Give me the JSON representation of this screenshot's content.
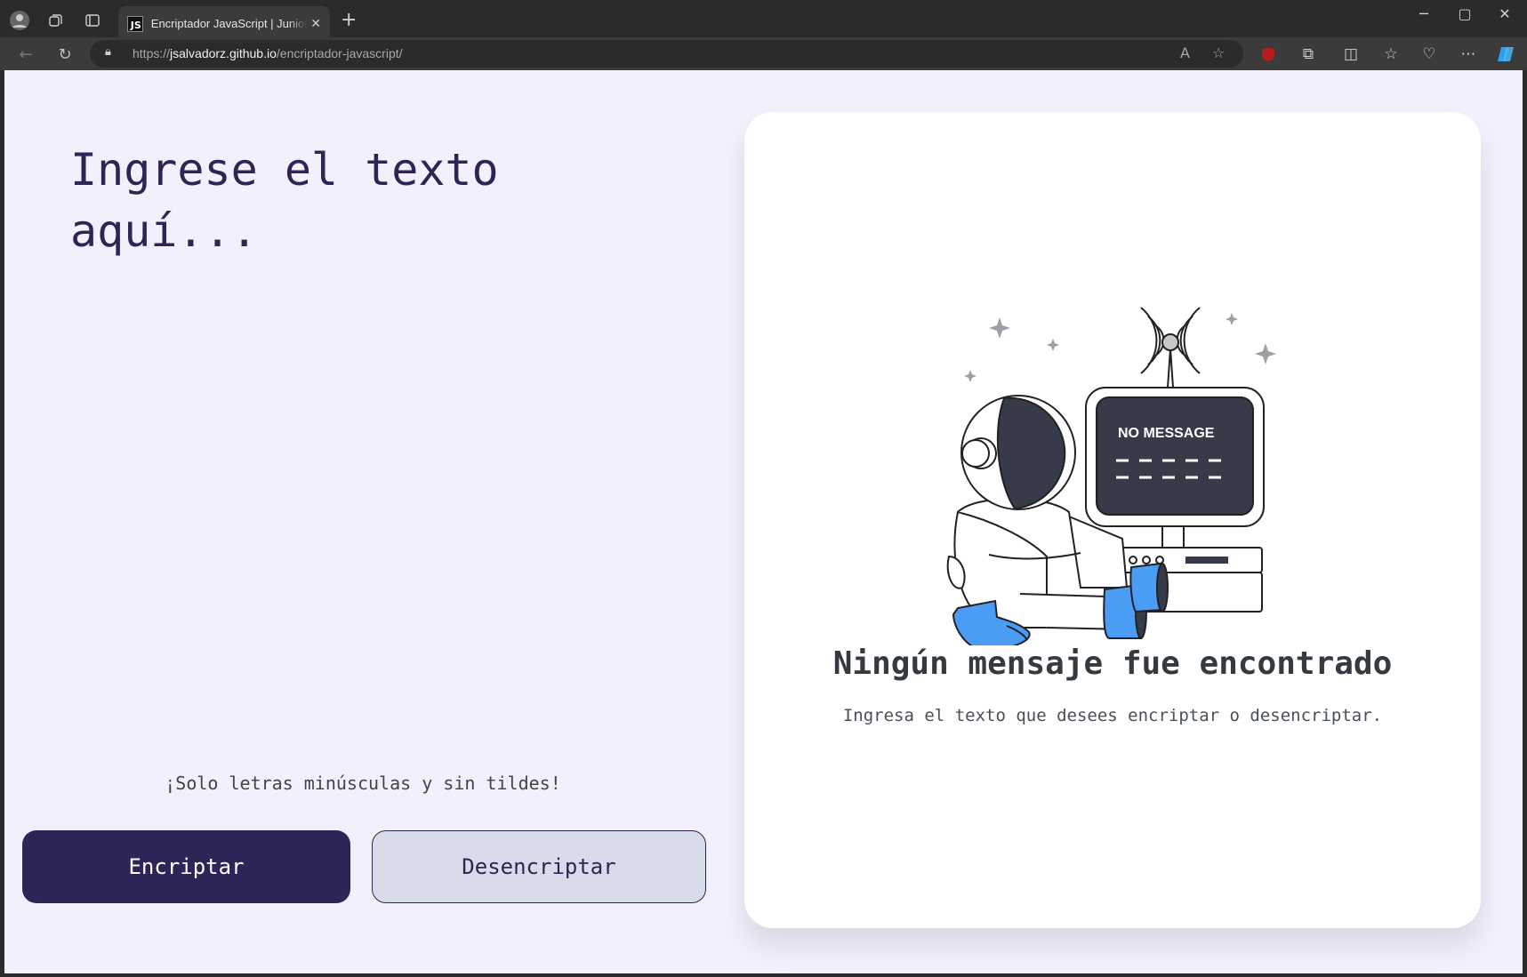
{
  "browser": {
    "tab_title": "Encriptador JavaScript | Junior Salvador",
    "tab_favicon": "JS",
    "url_prefix": "https://",
    "url_host": "jsalvadorz.github.io",
    "url_path": "/encriptador-javascript/",
    "icons": [
      "profile-icon",
      "workspaces-icon",
      "vertical-tabs-icon",
      "close-icon",
      "new-tab-icon",
      "back-icon",
      "refresh-icon",
      "lock-icon",
      "read-aloud-icon",
      "favorite-icon",
      "ublock-icon",
      "extensions-icon",
      "split-screen-icon",
      "favorites-icon",
      "browser-essentials-icon",
      "more-icon",
      "copilot-icon"
    ]
  },
  "page": {
    "input_placeholder": "Ingrese el texto aquí...",
    "hint": "¡Solo letras minúsculas y sin tildes!",
    "encrypt_label": "Encriptar",
    "decrypt_label": "Desencriptar",
    "result": {
      "screen_text": "NO MESSAGE",
      "title": "Ningún mensaje fue encontrado",
      "subtitle": "Ingresa el texto que desees encriptar o desencriptar."
    }
  },
  "colors": {
    "page_bg": "#f2f0fc",
    "primary": "#2d2457",
    "secondary": "#d8dcea",
    "accent_blue": "#4b9cf5"
  }
}
